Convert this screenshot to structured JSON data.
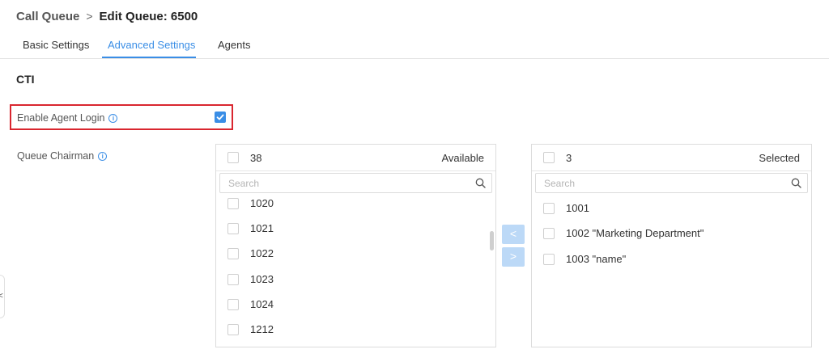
{
  "breadcrumb": {
    "parent": "Call Queue",
    "separator": ">",
    "current": "Edit Queue: 6500"
  },
  "tabs": [
    {
      "label": "Basic Settings",
      "active": false
    },
    {
      "label": "Advanced Settings",
      "active": true
    },
    {
      "label": "Agents",
      "active": false
    }
  ],
  "section_title": "CTI",
  "enable_agent_login": {
    "label": "Enable Agent Login",
    "checked": true
  },
  "queue_chairman": {
    "label": "Queue Chairman"
  },
  "available_panel": {
    "count": "38",
    "title": "Available",
    "search_placeholder": "Search",
    "items": [
      "1020",
      "1021",
      "1022",
      "1023",
      "1024",
      "1212"
    ]
  },
  "selected_panel": {
    "count": "3",
    "title": "Selected",
    "search_placeholder": "Search",
    "items": [
      "1001",
      "1002 \"Marketing Department\"",
      "1003 \"name\""
    ]
  },
  "transfer_buttons": {
    "left": "<",
    "right": ">"
  },
  "side_collapse": {
    "glyph": "<"
  },
  "colors": {
    "accent": "#3a8ee6",
    "highlight_border": "#d9262f",
    "transfer_button": "#bcd9f7"
  }
}
